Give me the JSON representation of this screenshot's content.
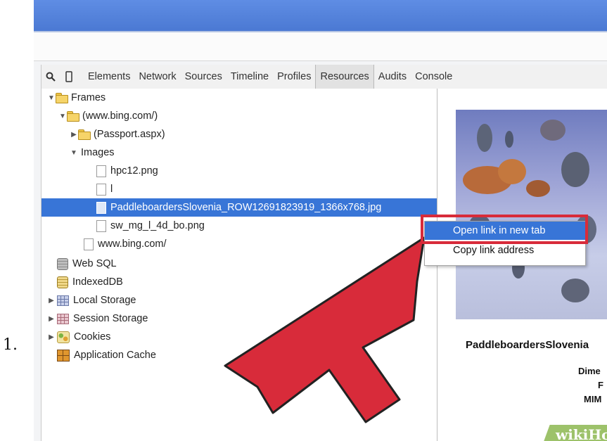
{
  "step_number": "1.",
  "toolbar": {
    "tabs": [
      {
        "label": "Elements"
      },
      {
        "label": "Network"
      },
      {
        "label": "Sources"
      },
      {
        "label": "Timeline"
      },
      {
        "label": "Profiles"
      },
      {
        "label": "Resources",
        "selected": true
      },
      {
        "label": "Audits"
      },
      {
        "label": "Console"
      }
    ]
  },
  "tree": {
    "frames": "Frames",
    "bing_frame": "(www.bing.com/)",
    "passport": "(Passport.aspx)",
    "images": "Images",
    "image_1": "hpc12.png",
    "image_2": "l",
    "image_3": "PaddleboardersSlovenia_ROW12691823919_1366x768.jpg",
    "image_4": "sw_mg_l_4d_bo.png",
    "bing_doc": "www.bing.com/",
    "web_sql": "Web SQL",
    "indexed_db": "IndexedDB",
    "local_storage": "Local Storage",
    "session_storage": "Session Storage",
    "cookies": "Cookies",
    "app_cache": "Application Cache"
  },
  "context_menu": {
    "open_new_tab": "Open link in new tab",
    "copy_link": "Copy link address"
  },
  "preview": {
    "name": "PaddleboardersSlovenia",
    "meta_1": "Dime",
    "meta_2": "F",
    "meta_3": "MIM"
  },
  "watermark": {
    "part1": "wiki",
    "part2": "How"
  },
  "colors": {
    "selection": "#3875d7",
    "highlight": "#d82b3a",
    "arrow": "#d82b3a"
  }
}
